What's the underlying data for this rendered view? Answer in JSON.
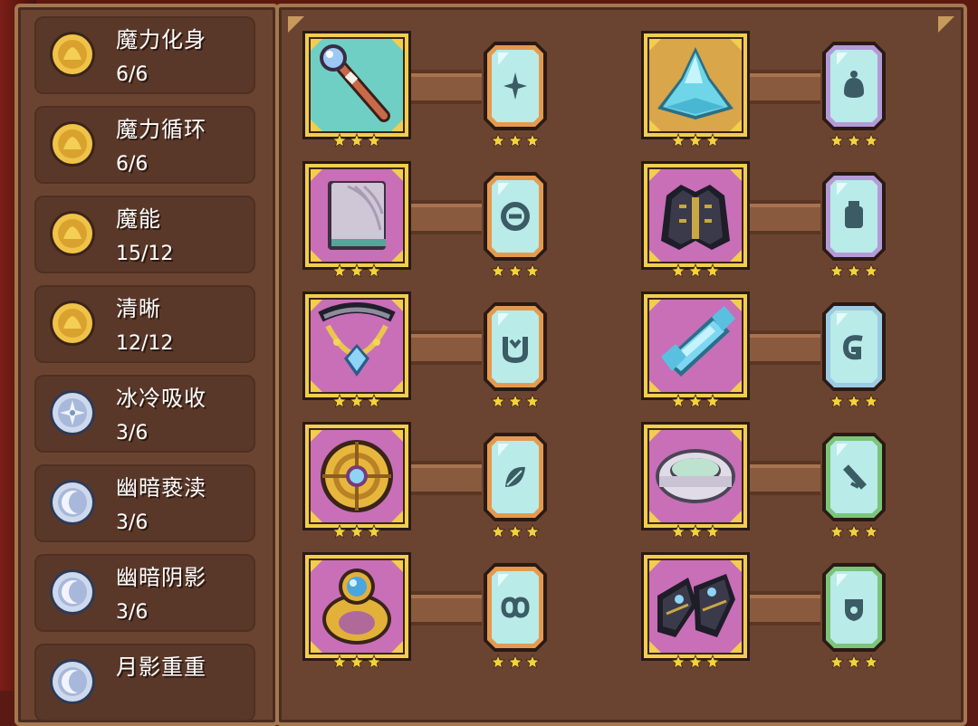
{
  "stats": [
    {
      "name": "魔力化身",
      "count": "6/6",
      "icon": "gold-coin-icon",
      "kind": "gold"
    },
    {
      "name": "魔力循环",
      "count": "6/6",
      "icon": "gold-coin-icon",
      "kind": "gold"
    },
    {
      "name": "魔能",
      "count": "15/12",
      "icon": "gold-coin-icon",
      "kind": "gold"
    },
    {
      "name": "清晰",
      "count": "12/12",
      "icon": "gold-coin-icon",
      "kind": "gold"
    },
    {
      "name": "冰冷吸收",
      "count": "3/6",
      "icon": "ice-sparkle-coin-icon",
      "kind": "ice"
    },
    {
      "name": "幽暗亵渎",
      "count": "3/6",
      "icon": "moon-coin-icon",
      "kind": "moon"
    },
    {
      "name": "幽暗阴影",
      "count": "3/6",
      "icon": "moon-coin-icon",
      "kind": "moon"
    },
    {
      "name": "月影重重",
      "count": "",
      "icon": "moon-coin-icon",
      "kind": "moon"
    }
  ],
  "equipment": [
    {
      "item": "staff-icon",
      "item_bg": "teal",
      "rune_border": "orange",
      "rune_symbol": "sparkle",
      "stars": 3
    },
    {
      "item": "crystal-hat-icon",
      "item_bg": "gold",
      "rune_border": "purple",
      "rune_symbol": "blob",
      "stars": 3
    },
    {
      "item": "spellbook-icon",
      "item_bg": "pink",
      "rune_border": "orange",
      "rune_symbol": "swirl",
      "stars": 3
    },
    {
      "item": "dark-robe-icon",
      "item_bg": "pink",
      "rune_border": "purple",
      "rune_symbol": "jar",
      "stars": 3
    },
    {
      "item": "crystal-necklace-icon",
      "item_bg": "pink",
      "rune_border": "orange",
      "rune_symbol": "cup",
      "stars": 3
    },
    {
      "item": "ice-bracer-icon",
      "item_bg": "pink",
      "rune_border": "blue",
      "rune_symbol": "hook",
      "stars": 3
    },
    {
      "item": "golden-amulet-icon",
      "item_bg": "pink",
      "rune_border": "orange",
      "rune_symbol": "leaf",
      "stars": 3
    },
    {
      "item": "silver-bracelet-icon",
      "item_bg": "pink",
      "rune_border": "green",
      "rune_symbol": "slash",
      "stars": 3
    },
    {
      "item": "sapphire-ring-icon",
      "item_bg": "pink",
      "rune_border": "orange",
      "rune_symbol": "infinity",
      "stars": 3
    },
    {
      "item": "dark-boots-icon",
      "item_bg": "pink",
      "rune_border": "green",
      "rune_symbol": "shield",
      "stars": 3
    }
  ],
  "colors": {
    "panel": "#6b4431",
    "frame": "#a4774f",
    "gold_frame": "#f2cd4e",
    "teal_bg": "#6fcfc4",
    "pink_bg": "#c86fb8",
    "gold_bg": "#d9a64a",
    "rune_fill": "#b9ebe8",
    "rune_orange": "#e39a4f",
    "rune_purple": "#b59ad8",
    "rune_blue": "#9ccbe6",
    "rune_green": "#7cc47a",
    "star": "#f4d23c"
  }
}
